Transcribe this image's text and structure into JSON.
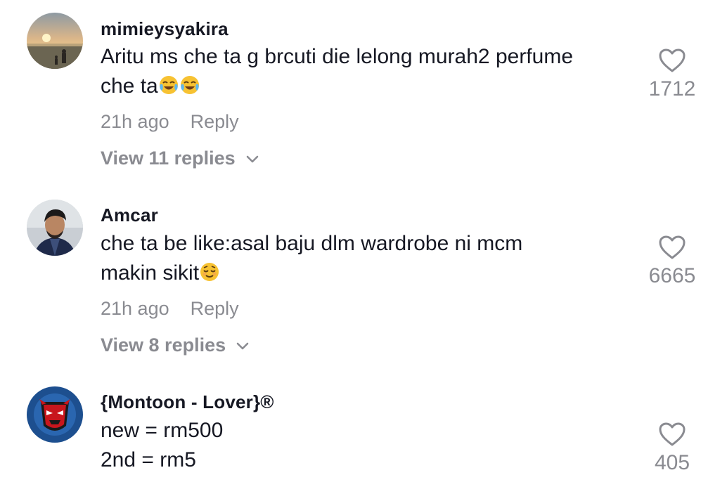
{
  "comments": [
    {
      "username": "mimieysyakira",
      "text_lines": [
        "Aritu ms che ta g brcuti die lelong murah2 perfume",
        "che ta"
      ],
      "emojis": [
        "face-with-tears-of-joy",
        "face-with-tears-of-joy"
      ],
      "time": "21h ago",
      "reply_label": "Reply",
      "view_replies": "View 11 replies",
      "likes": "1712",
      "avatar": "sunset-beach-photo"
    },
    {
      "username": "Amcar",
      "text_lines": [
        "che ta be like:asal baju dlm wardrobe ni mcm",
        "makin sikit"
      ],
      "emojis": [
        "relieved-face"
      ],
      "time": "21h ago",
      "reply_label": "Reply",
      "view_replies": "View 8 replies",
      "likes": "6665",
      "avatar": "man-portrait-photo"
    },
    {
      "username": "{Montoon - Lover}®",
      "text_lines": [
        "new = rm500",
        "2nd = rm5"
      ],
      "time": "",
      "likes": "405",
      "avatar": "red-mask-emblem"
    }
  ],
  "colors": {
    "text": "#161823",
    "muted": "#8a8b91",
    "background": "#ffffff"
  }
}
